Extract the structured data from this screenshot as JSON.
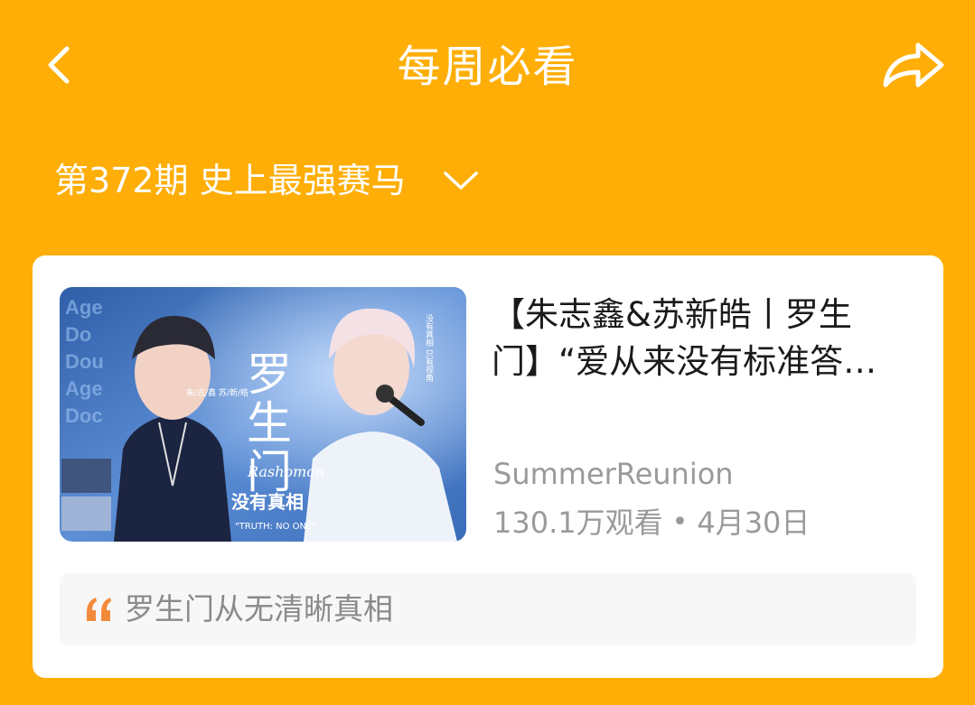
{
  "header": {
    "title": "每周必看",
    "back_icon": "chevron-left-icon",
    "share_icon": "share-arrow-icon"
  },
  "issue_selector": {
    "label": "第372期 史上最强赛马",
    "icon": "chevron-down-icon"
  },
  "video_card": {
    "title": "【朱志鑫&苏新皓丨罗生门】“爱从来没有标准答…",
    "author": "SummerReunion",
    "views": "130.1万观看",
    "separator": "•",
    "date": "4月30日",
    "quote_icon": "quote-mark-icon",
    "quote": "罗生门从无清晰真相",
    "thumbnail": {
      "big_title": "罗生门",
      "subtitle": "没有真相",
      "names": "朱/志/鑫 苏/新/皓",
      "caption": "\"TRUTH: NO ONE\"",
      "script_text": "Rashomon",
      "side_text": "没有真相 只有视角"
    }
  },
  "colors": {
    "background": "#FEAE07",
    "card": "#FFFFFF",
    "quote_mark": "#F28A3C",
    "secondary_text": "#9A9A9A"
  }
}
